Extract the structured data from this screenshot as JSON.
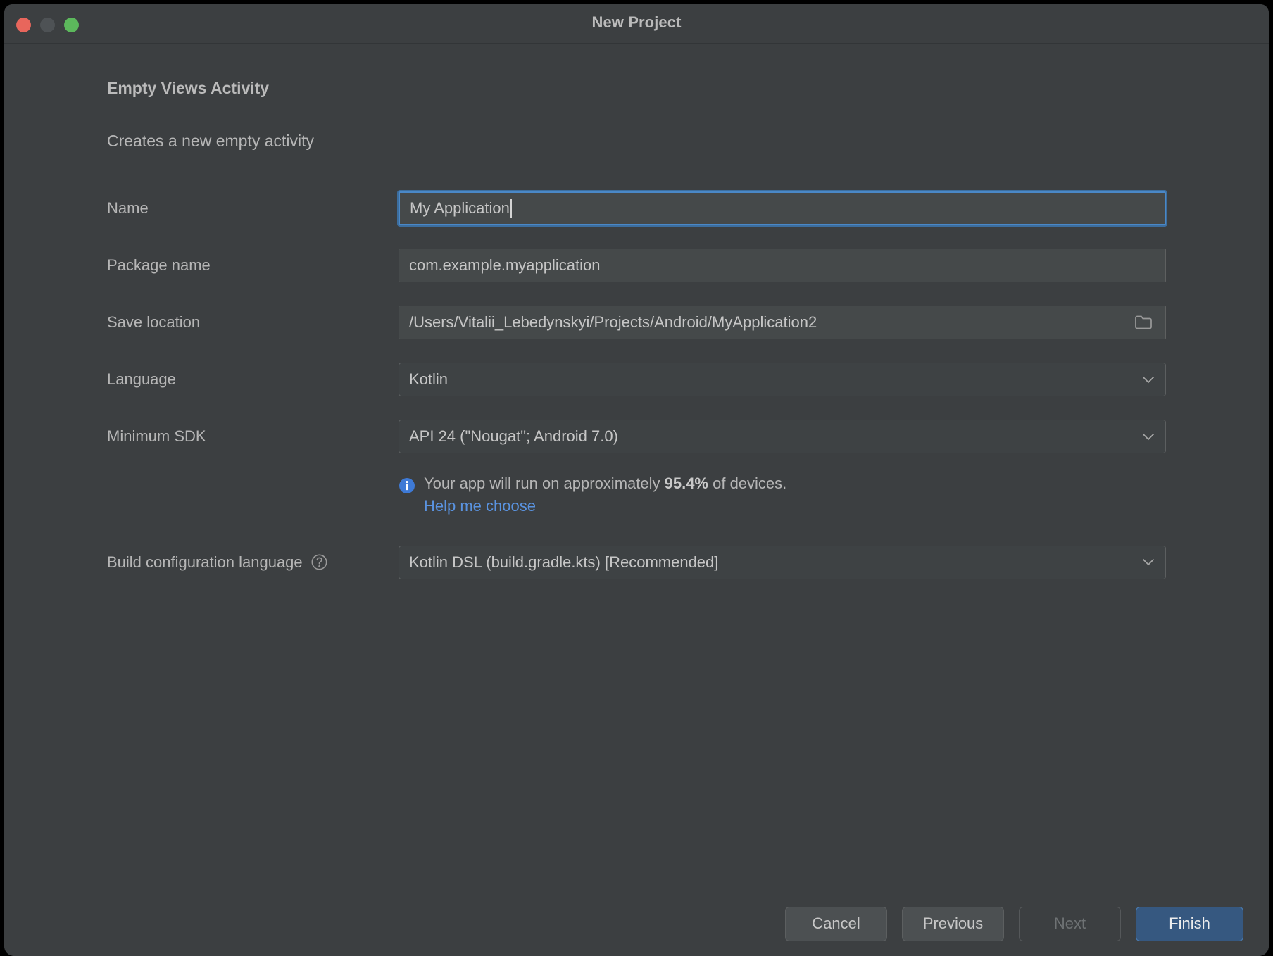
{
  "window": {
    "title": "New Project",
    "traffic_lights": [
      {
        "name": "close",
        "color": "#E8665C"
      },
      {
        "name": "minimize",
        "color": "#4E5255"
      },
      {
        "name": "zoom",
        "color": "#5CB85C"
      }
    ]
  },
  "header": {
    "template_title": "Empty Views Activity",
    "template_subtitle": "Creates a new empty activity"
  },
  "form": {
    "name": {
      "label": "Name",
      "value": "My Application",
      "focused": true
    },
    "package_name": {
      "label": "Package name",
      "value": "com.example.myapplication"
    },
    "save_location": {
      "label": "Save location",
      "value": "/Users/Vitalii_Lebedynskyi/Projects/Android/MyApplication2",
      "browse_icon": "folder-icon"
    },
    "language": {
      "label": "Language",
      "value": "Kotlin",
      "dropdown_icon": "chevron-down-icon"
    },
    "minimum_sdk": {
      "label": "Minimum SDK",
      "value": "API 24 (\"Nougat\"; Android 7.0)",
      "dropdown_icon": "chevron-down-icon"
    },
    "sdk_info": {
      "icon": "info-icon",
      "text_before": "Your app will run on approximately ",
      "percent": "95.4%",
      "text_after": " of devices.",
      "link": "Help me choose"
    },
    "build_config_language": {
      "label": "Build configuration language",
      "help_icon": "question-mark-icon",
      "value": "Kotlin DSL (build.gradle.kts) [Recommended]",
      "dropdown_icon": "chevron-down-icon"
    }
  },
  "footer": {
    "cancel": "Cancel",
    "previous": "Previous",
    "next": "Next",
    "finish": "Finish"
  },
  "colors": {
    "window_bg": "#3C3F41",
    "accent_blue": "#365880",
    "link_blue": "#5A93E0",
    "focus_border": "#4A88C7"
  }
}
